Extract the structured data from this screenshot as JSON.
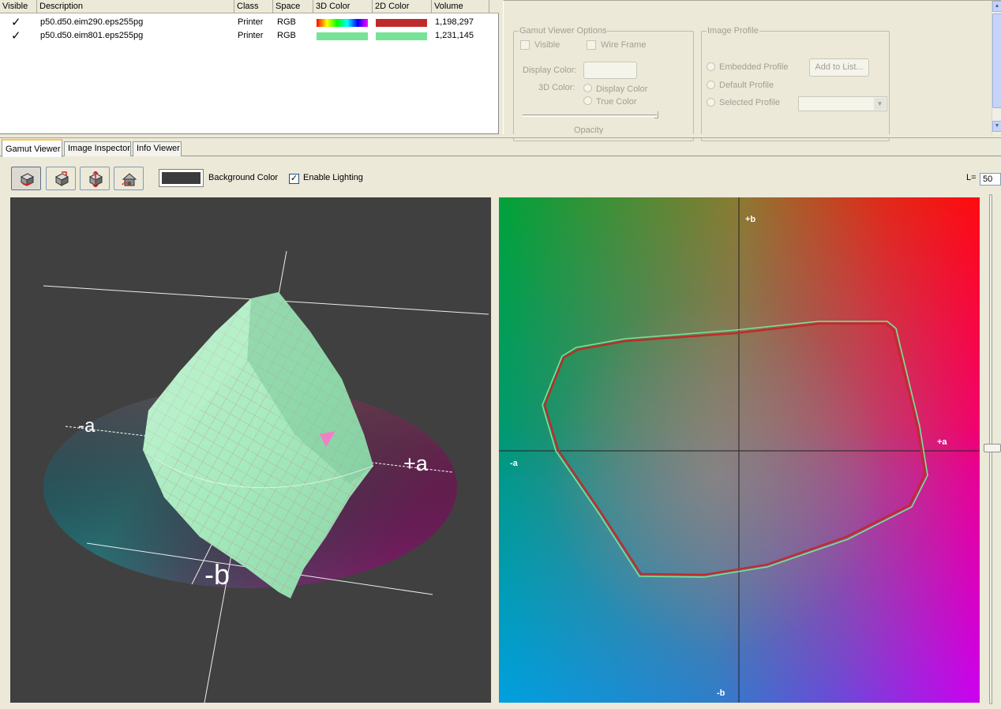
{
  "profile_list": {
    "columns": [
      "Visible",
      "Description",
      "Class",
      "Space",
      "3D Color",
      "2D Color",
      "Volume"
    ],
    "rows": [
      {
        "visible_mark": "✓",
        "description": "p50.d50.eim290.eps255pg",
        "class": "Printer",
        "space": "RGB",
        "color_3d": "rainbow",
        "color_2d": "#bf2b2b",
        "volume": "1,198,297"
      },
      {
        "visible_mark": "✓",
        "description": "p50.d50.eim801.eps255pg",
        "class": "Printer",
        "space": "RGB",
        "color_3d": "#77e397",
        "color_2d": "#77e397",
        "volume": "1,231,145"
      }
    ]
  },
  "gamut_options": {
    "title": "Gamut Viewer Options",
    "visible_label": "Visible",
    "wire_frame_label": "Wire Frame",
    "display_color_label": "Display Color:",
    "color_3d_label": "3D Color:",
    "display_color_option": "Display Color",
    "true_color_option": "True Color",
    "opacity_label": "Opacity"
  },
  "image_profile": {
    "title": "Image Profile",
    "embedded_label": "Embedded Profile",
    "default_label": "Default Profile",
    "selected_label": "Selected Profile",
    "add_button": "Add to List..."
  },
  "tabs": [
    "Gamut Viewer",
    "Image Inspector",
    "Info Viewer"
  ],
  "toolbar": {
    "background_color_label": "Background Color",
    "background_color": "#3b3b3b",
    "enable_lighting_label": "Enable Lighting",
    "enable_lighting_mark": "✓",
    "l_label": "L=",
    "l_value": "50",
    "icons": [
      "rotate-view-icon",
      "zoom-view-icon",
      "pan-view-icon",
      "home-view-icon"
    ]
  },
  "viewer3d": {
    "label_neg_a": "-a",
    "label_pos_a": "+a",
    "label_neg_b": "-b"
  },
  "viewer2d": {
    "label_pos_b": "+b",
    "label_neg_b": "-b",
    "label_pos_a": "+a",
    "label_neg_a": "-a",
    "gamut_colors": [
      "#bf2b2b",
      "#77e397"
    ]
  }
}
